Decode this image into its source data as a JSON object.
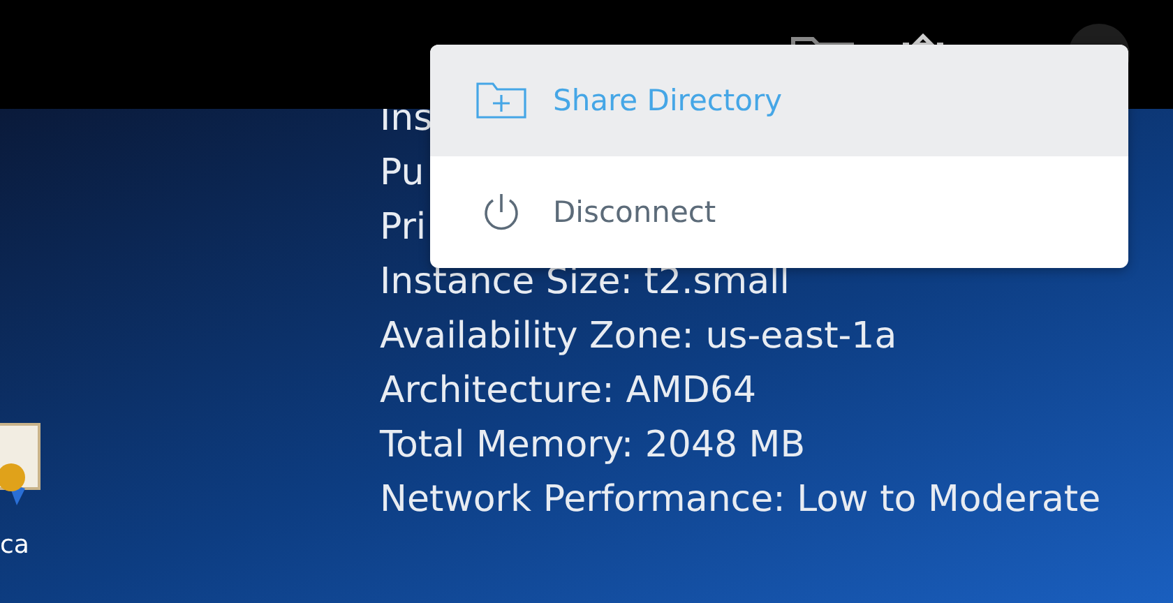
{
  "desktop": {
    "icons": [
      {
        "label": "ca"
      }
    ],
    "info_lines": [
      "Ins",
      "Pu",
      "Pri",
      "Instance Size: t2.small",
      "Availability Zone: us-east-1a",
      "Architecture: AMD64",
      "Total Memory: 2048 MB",
      "Network Performance: Low to Moderate"
    ]
  },
  "menu": {
    "items": [
      {
        "kind": "share",
        "label": "Share Directory",
        "selected": true
      },
      {
        "kind": "disconnect",
        "label": "Disconnect",
        "selected": false
      }
    ]
  }
}
